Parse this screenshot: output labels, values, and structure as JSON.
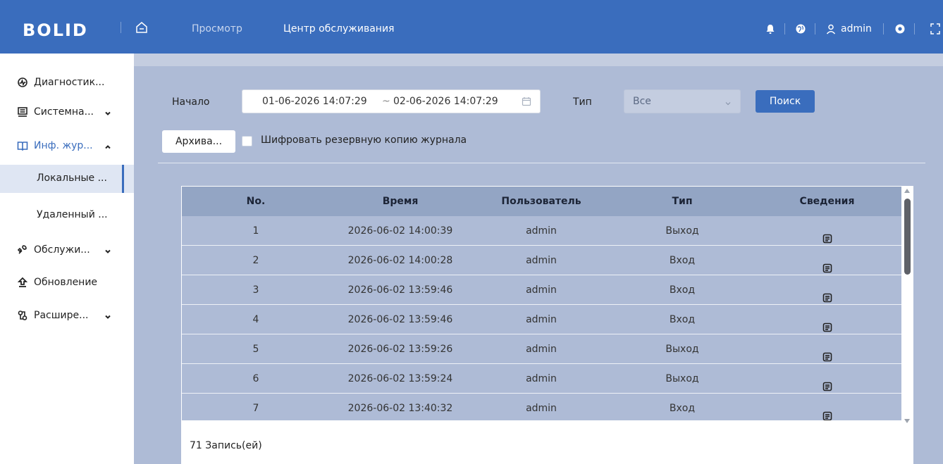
{
  "header": {
    "logo_text": "BOLID",
    "nav": [
      {
        "label": "Просмотр",
        "active": false
      },
      {
        "label": "Центр обслуживания",
        "active": true
      }
    ],
    "user": "admin",
    "icons": [
      "home-icon",
      "bell-icon",
      "globe-icon",
      "user-icon",
      "gear-icon",
      "fullscreen-icon"
    ],
    "colors": {
      "bar": "#3a6dbd",
      "text": "#ffffff"
    }
  },
  "sidebar": {
    "items": [
      {
        "label": "Диагностик...",
        "icon": "diagnostics-icon"
      },
      {
        "label": "Системна...",
        "icon": "system-icon",
        "chevron": "down"
      },
      {
        "label": "Инф. жур...",
        "icon": "book-icon",
        "chevron": "up",
        "expanded": true
      },
      {
        "label": "Локальные ...",
        "sub": true,
        "selected": true
      },
      {
        "label": "Удаленный ...",
        "sub": true
      },
      {
        "label": "Обслужи...",
        "icon": "maintenance-icon",
        "chevron": "down"
      },
      {
        "label": "Обновление",
        "icon": "upgrade-icon"
      },
      {
        "label": "Расшире...",
        "icon": "extension-icon",
        "chevron": "down"
      }
    ]
  },
  "filters": {
    "start_label": "Начало",
    "date_from": "01-06-2026 14:07:29",
    "date_sep": "~",
    "date_to": "02-06-2026 14:07:29",
    "type_label": "Тип",
    "type_value": "Все",
    "search_button": "Поиск",
    "archive_button": "Архива...",
    "encrypt_label": "Шифровать резервную копию журнала",
    "encrypt_checked": false
  },
  "table": {
    "columns": [
      "No.",
      "Время",
      "Пользователь",
      "Тип",
      "Сведения"
    ],
    "rows": [
      {
        "no": "1",
        "time": "2026-06-02 14:00:39",
        "user": "admin",
        "type": "Выход"
      },
      {
        "no": "2",
        "time": "2026-06-02 14:00:28",
        "user": "admin",
        "type": "Вход"
      },
      {
        "no": "3",
        "time": "2026-06-02 13:59:46",
        "user": "admin",
        "type": "Вход"
      },
      {
        "no": "4",
        "time": "2026-06-02 13:59:46",
        "user": "admin",
        "type": "Вход"
      },
      {
        "no": "5",
        "time": "2026-06-02 13:59:26",
        "user": "admin",
        "type": "Выход"
      },
      {
        "no": "6",
        "time": "2026-06-02 13:59:24",
        "user": "admin",
        "type": "Выход"
      },
      {
        "no": "7",
        "time": "2026-06-02 13:40:32",
        "user": "admin",
        "type": "Вход"
      }
    ],
    "record_count": "71 Запись(ей)"
  }
}
